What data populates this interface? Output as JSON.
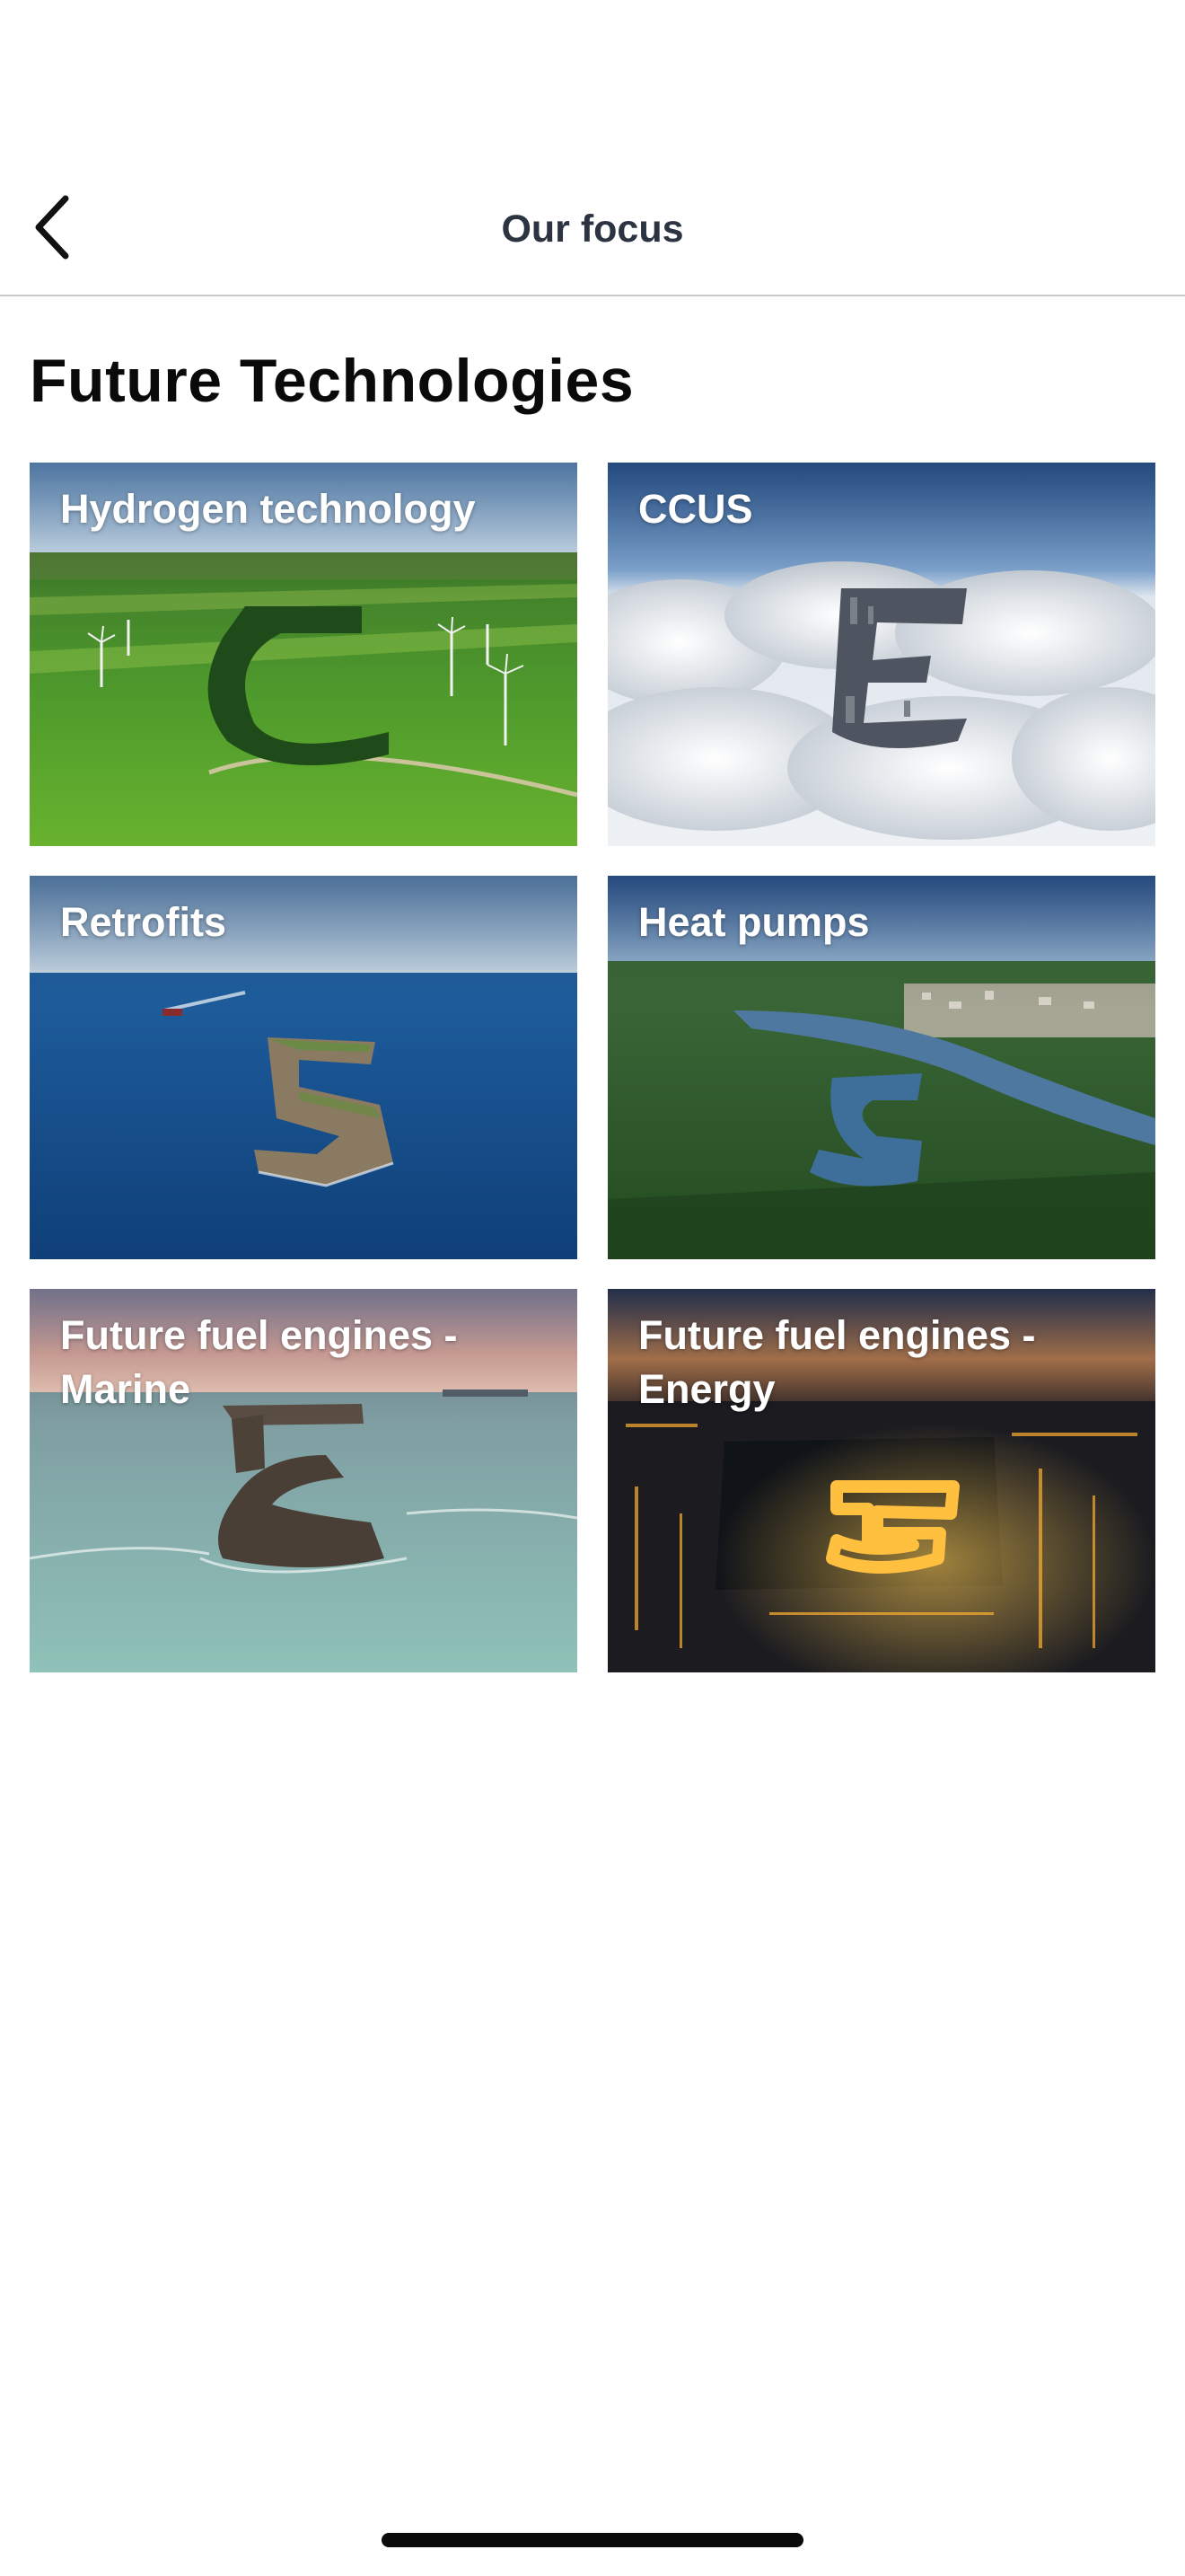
{
  "nav": {
    "title": "Our focus",
    "back_icon": "chevron-left-icon"
  },
  "section": {
    "title": "Future Technologies"
  },
  "tiles": [
    {
      "label": "Hydrogen technology"
    },
    {
      "label": "CCUS"
    },
    {
      "label": "Retrofits"
    },
    {
      "label": "Heat pumps"
    },
    {
      "label": "Future fuel engines - Marine"
    },
    {
      "label": "Future fuel engines - Energy"
    }
  ],
  "colors": {
    "nav_title": "#2b3440",
    "section_title": "#0a0a0a",
    "tile_label": "#ffffff",
    "divider": "#c9c9c9"
  }
}
